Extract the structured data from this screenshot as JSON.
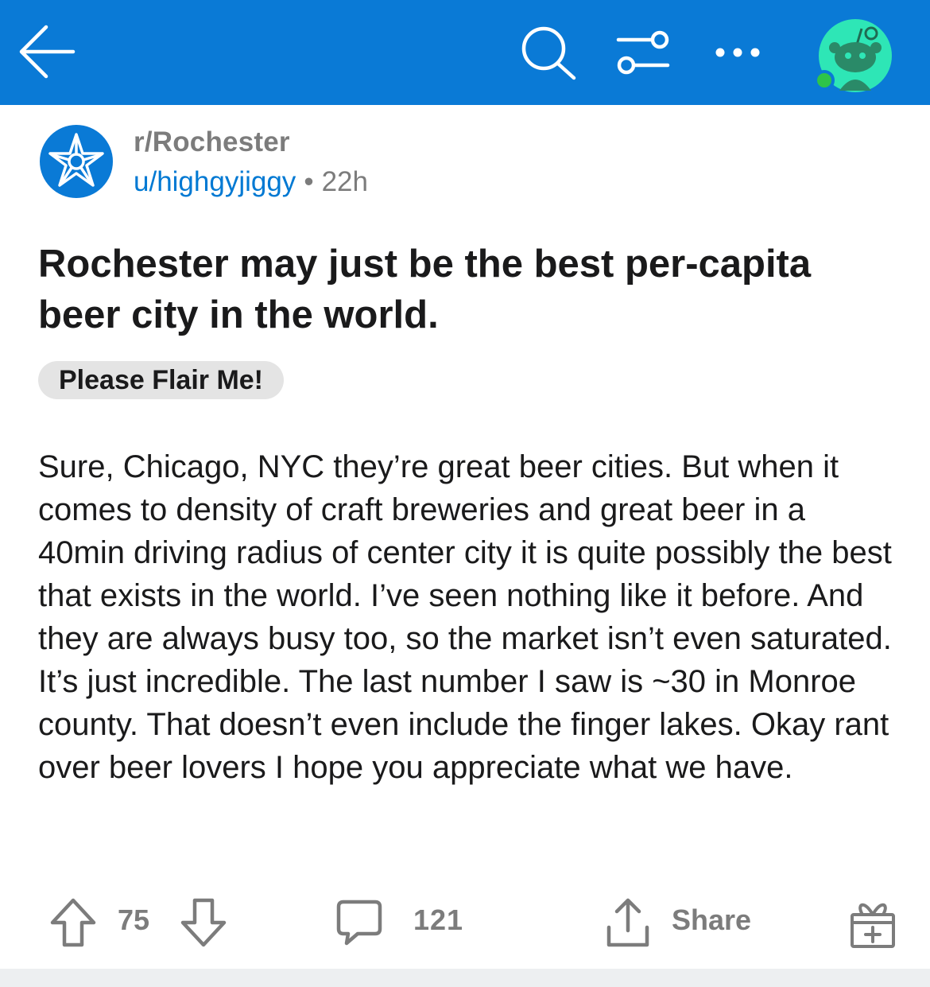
{
  "colors": {
    "header_bg": "#0a7ad6",
    "username": "#0079d3",
    "meta_gray": "#7c7c7c",
    "flair_bg": "#e4e4e4",
    "avatar_bg": "#2ee6b6"
  },
  "topbar": {
    "icons": [
      "back-arrow-icon",
      "search-icon",
      "sort-filter-icon",
      "more-icon",
      "avatar-icon"
    ]
  },
  "post": {
    "subreddit": "r/Rochester",
    "author": "u/highgyjiggy",
    "separator": "•",
    "age": "22h",
    "title": "Rochester may just be the best per-capita beer city in the world.",
    "flair": "Please Flair Me!",
    "body": "Sure, Chicago, NYC they’re great beer cities. But when it comes to density of craft breweries and great beer in a 40min driving radius of center city it is quite possibly the best that exists in the world. I’ve seen nothing like it before. And they are always busy too, so the market isn’t even saturated. It’s just incredible. The last number I saw is ~30 in Monroe county. That doesn’t even include the finger lakes. Okay rant over beer lovers I hope you appreciate what we have."
  },
  "actions": {
    "score": "75",
    "comments": "121",
    "share_label": "Share"
  }
}
